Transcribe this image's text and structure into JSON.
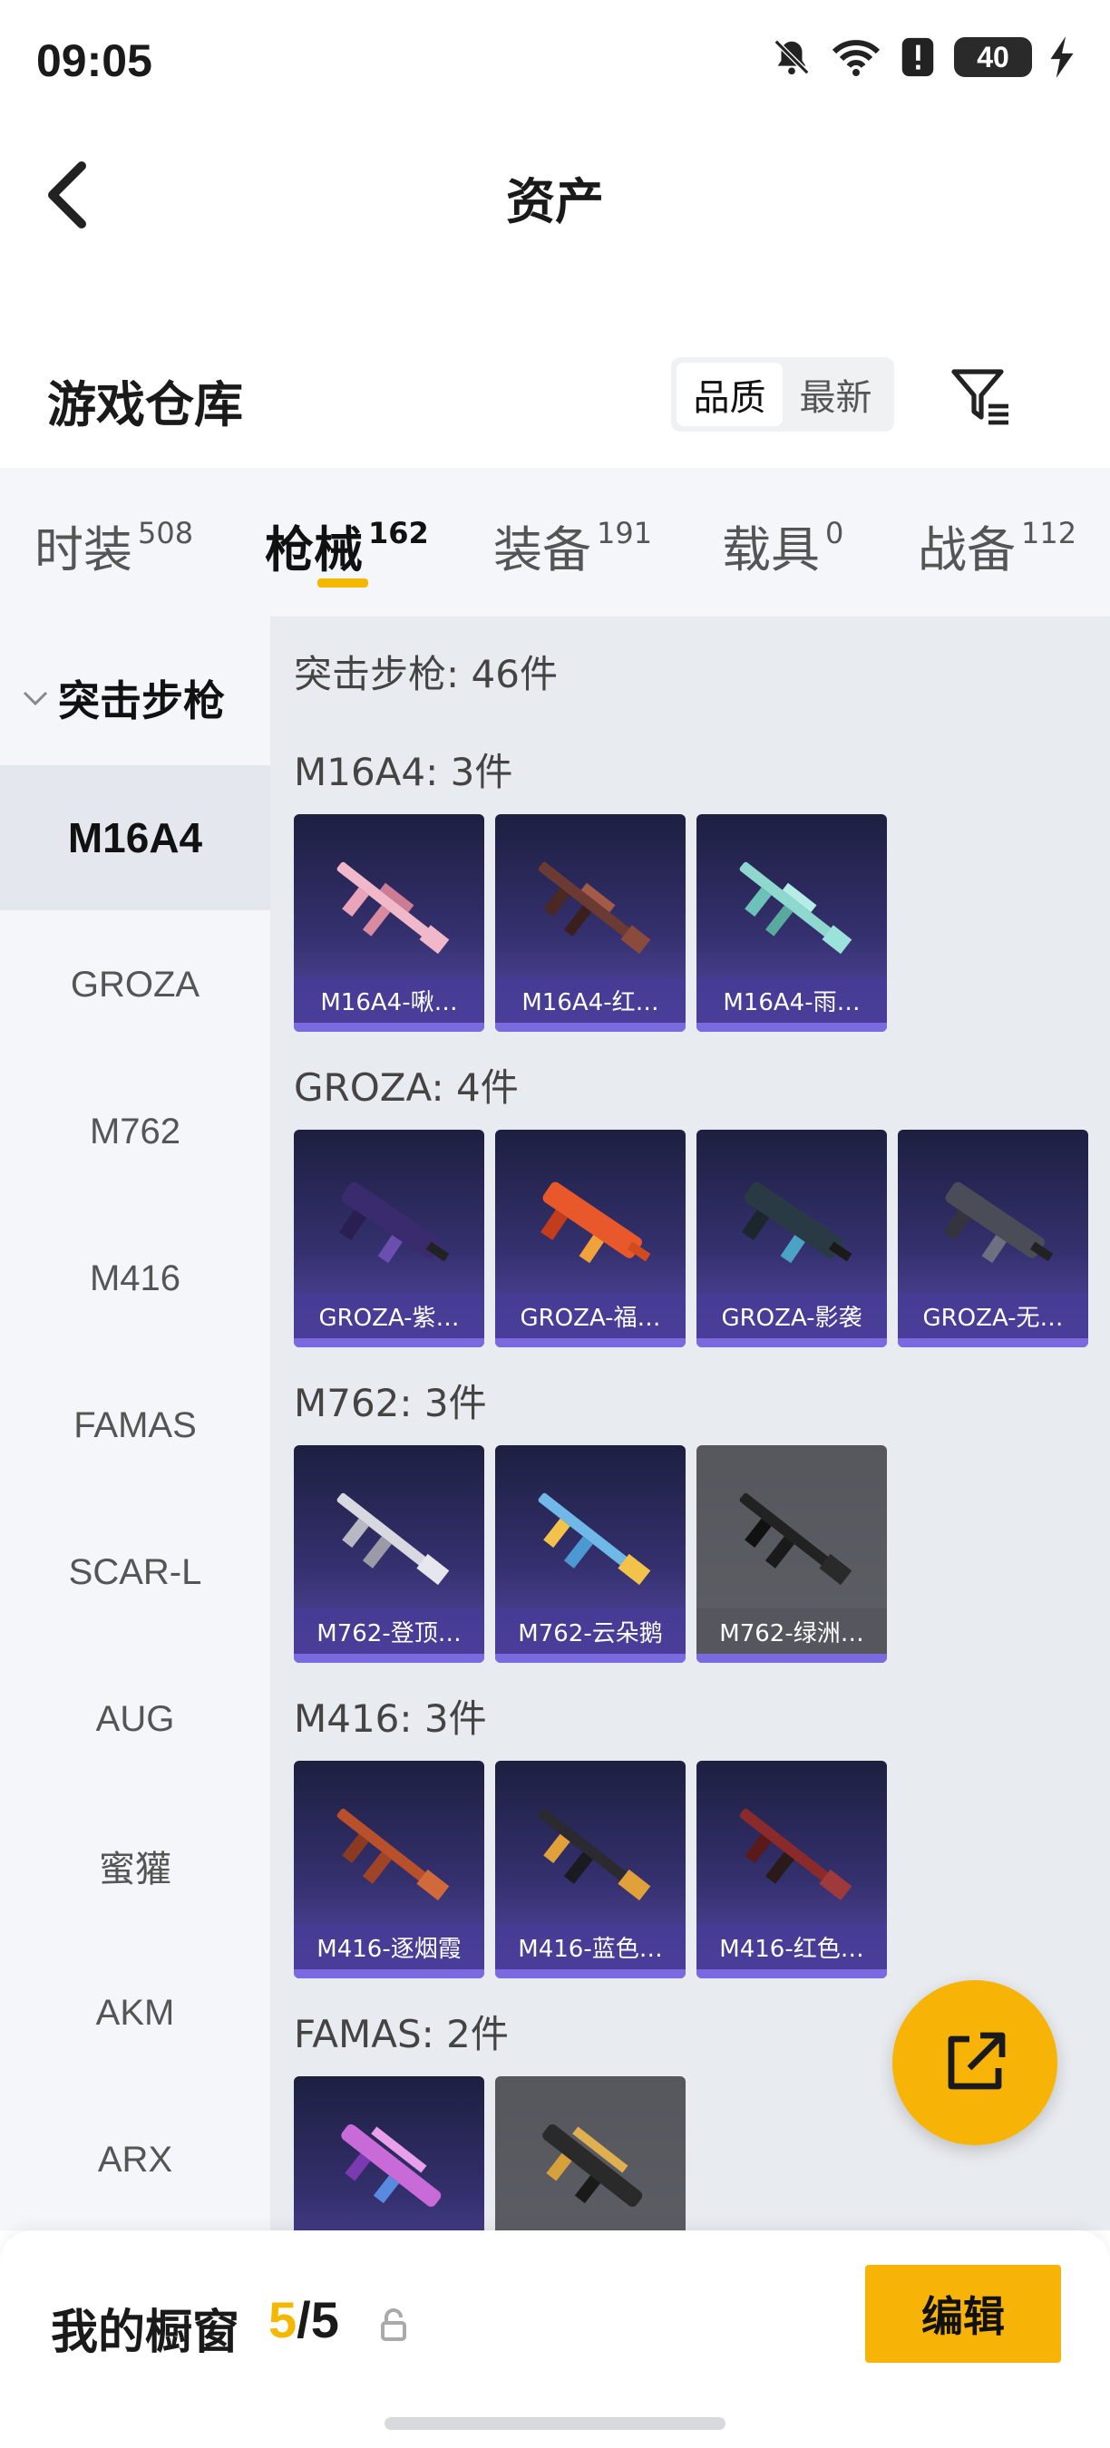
{
  "status_bar": {
    "time": "09:05",
    "battery": "40"
  },
  "header": {
    "title": "资产"
  },
  "section": {
    "title": "游戏仓库",
    "sort_options": [
      "品质",
      "最新"
    ],
    "sort_active": "品质"
  },
  "tabs": [
    {
      "label": "时装",
      "count": "508"
    },
    {
      "label": "枪械",
      "count": "162"
    },
    {
      "label": "装备",
      "count": "191"
    },
    {
      "label": "载具",
      "count": "0"
    },
    {
      "label": "战备",
      "count": "112"
    }
  ],
  "sidebar": {
    "group": "突击步枪",
    "items": [
      "M16A4",
      "GROZA",
      "M762",
      "M416",
      "FAMAS",
      "SCAR-L",
      "AUG",
      "蜜獾",
      "AKM",
      "ARX"
    ]
  },
  "main": {
    "total": "突击步枪: 46件",
    "groups": [
      {
        "label": "M16A4: 3件",
        "items": [
          "M16A4-啾…",
          "M16A4-红…",
          "M16A4-雨…"
        ]
      },
      {
        "label": "GROZA: 4件",
        "items": [
          "GROZA-紫…",
          "GROZA-福…",
          "GROZA-影袭",
          "GROZA-无…"
        ]
      },
      {
        "label": "M762: 3件",
        "items": [
          "M762-登顶…",
          "M762-云朵鹅",
          "M762-绿洲…"
        ]
      },
      {
        "label": "M416: 3件",
        "items": [
          "M416-逐烟霞",
          "M416-蓝色…",
          "M416-红色…"
        ]
      },
      {
        "label": "FAMAS: 2件",
        "items": [
          "",
          ""
        ]
      }
    ]
  },
  "bottom_bar": {
    "label": "我的橱窗",
    "current": "5",
    "separator": "/",
    "total": "5",
    "edit_label": "编辑"
  },
  "colors": {
    "accent": "#f8b406",
    "card_purple": "#34306e",
    "card_gray": "#5d5f66"
  }
}
